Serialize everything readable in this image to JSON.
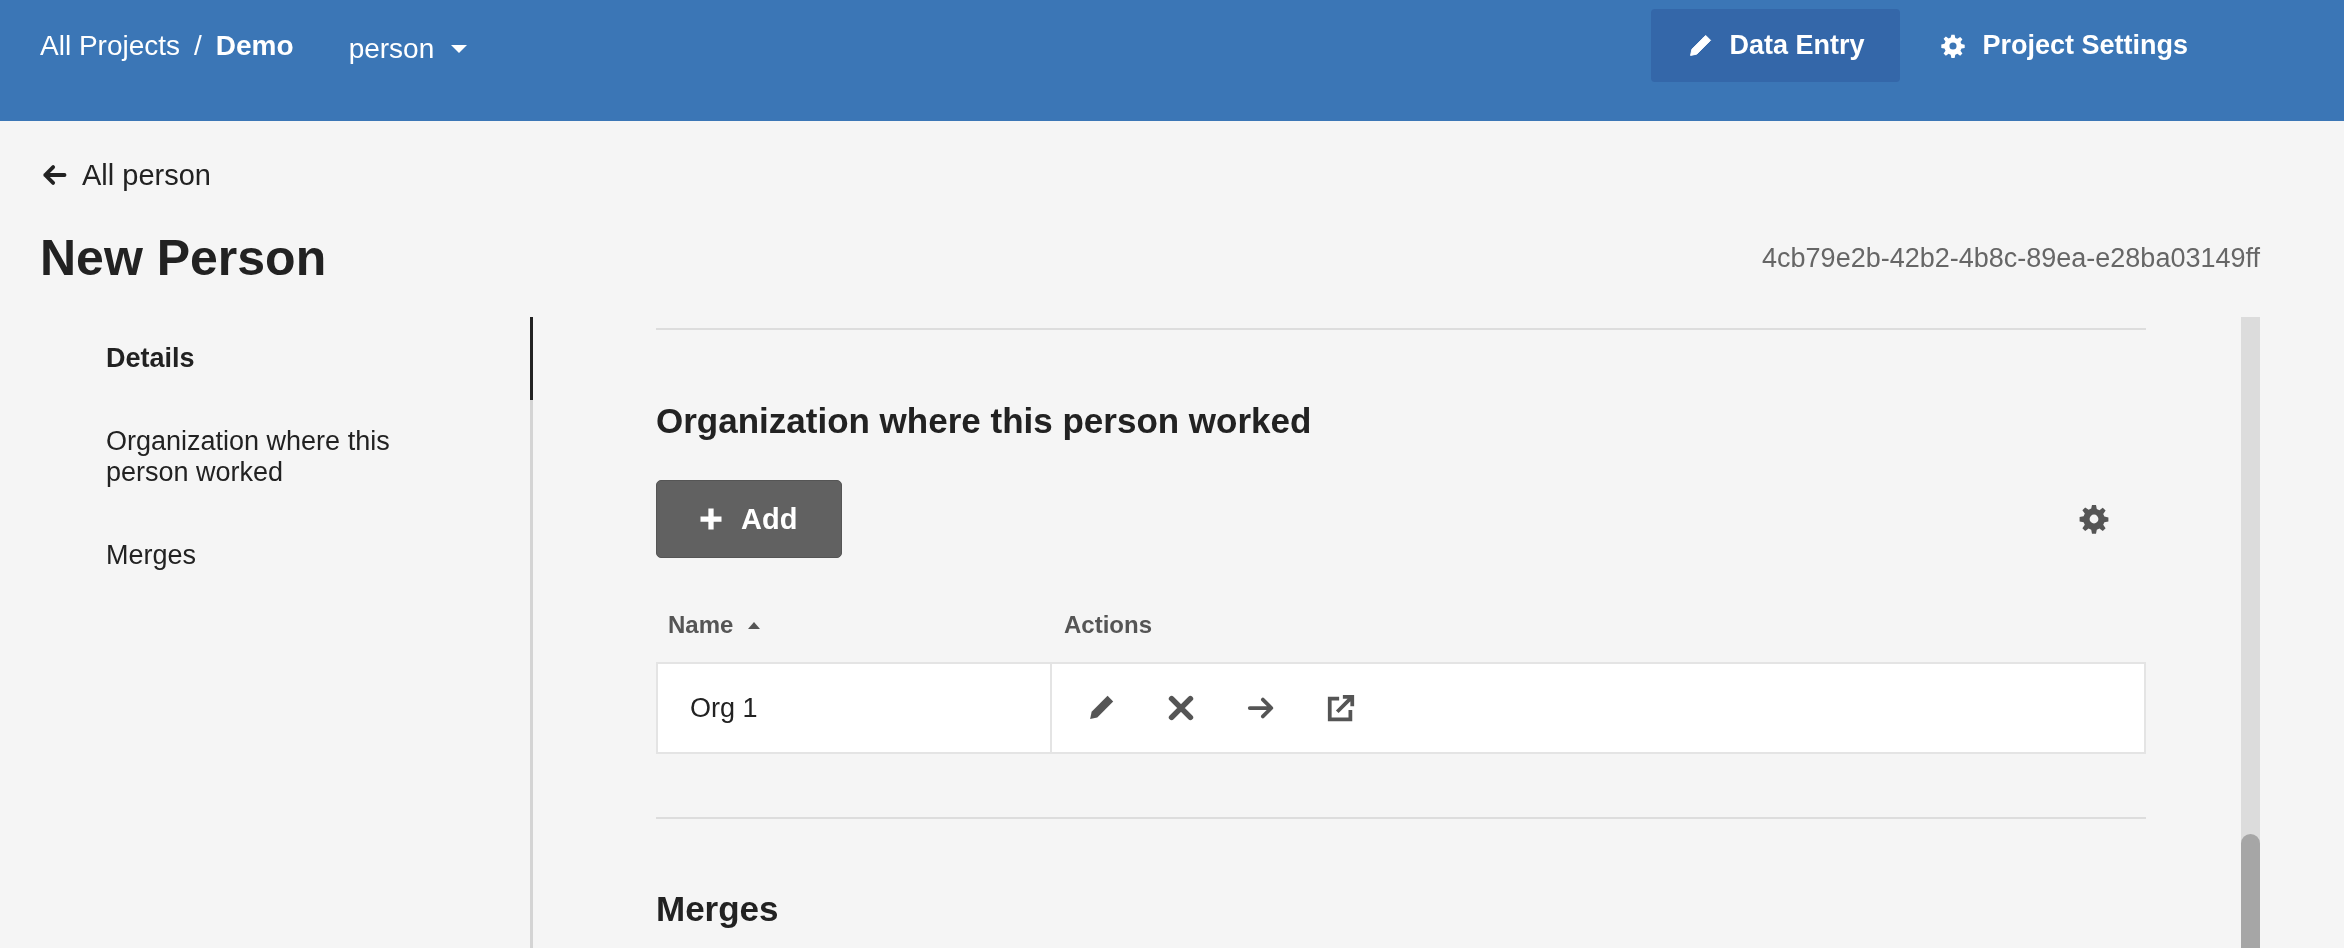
{
  "header": {
    "breadcrumb": [
      {
        "label": "All Projects",
        "current": false
      },
      {
        "label": "Demo",
        "current": true
      }
    ],
    "separator": "/",
    "entity_selector": "person",
    "nav": [
      {
        "label": "Data Entry",
        "selected": true
      },
      {
        "label": "Project Settings",
        "selected": false
      }
    ]
  },
  "back_link": "All person",
  "title": "New Person",
  "record_id": "4cb79e2b-42b2-4b8c-89ea-e28ba03149ff",
  "sidebar": {
    "items": [
      {
        "label": "Details",
        "selected": true
      },
      {
        "label": "Organization where this person worked",
        "selected": false
      },
      {
        "label": "Merges",
        "selected": false
      }
    ]
  },
  "sections": [
    {
      "title": "Organization where this person worked",
      "add_button": "Add",
      "table": {
        "columns": [
          {
            "label": "Name",
            "sorted_ascending": true
          },
          {
            "label": "Actions",
            "sorted_ascending": false
          }
        ],
        "rows": [
          {
            "name": "Org 1"
          }
        ]
      }
    },
    {
      "title": "Merges"
    }
  ]
}
